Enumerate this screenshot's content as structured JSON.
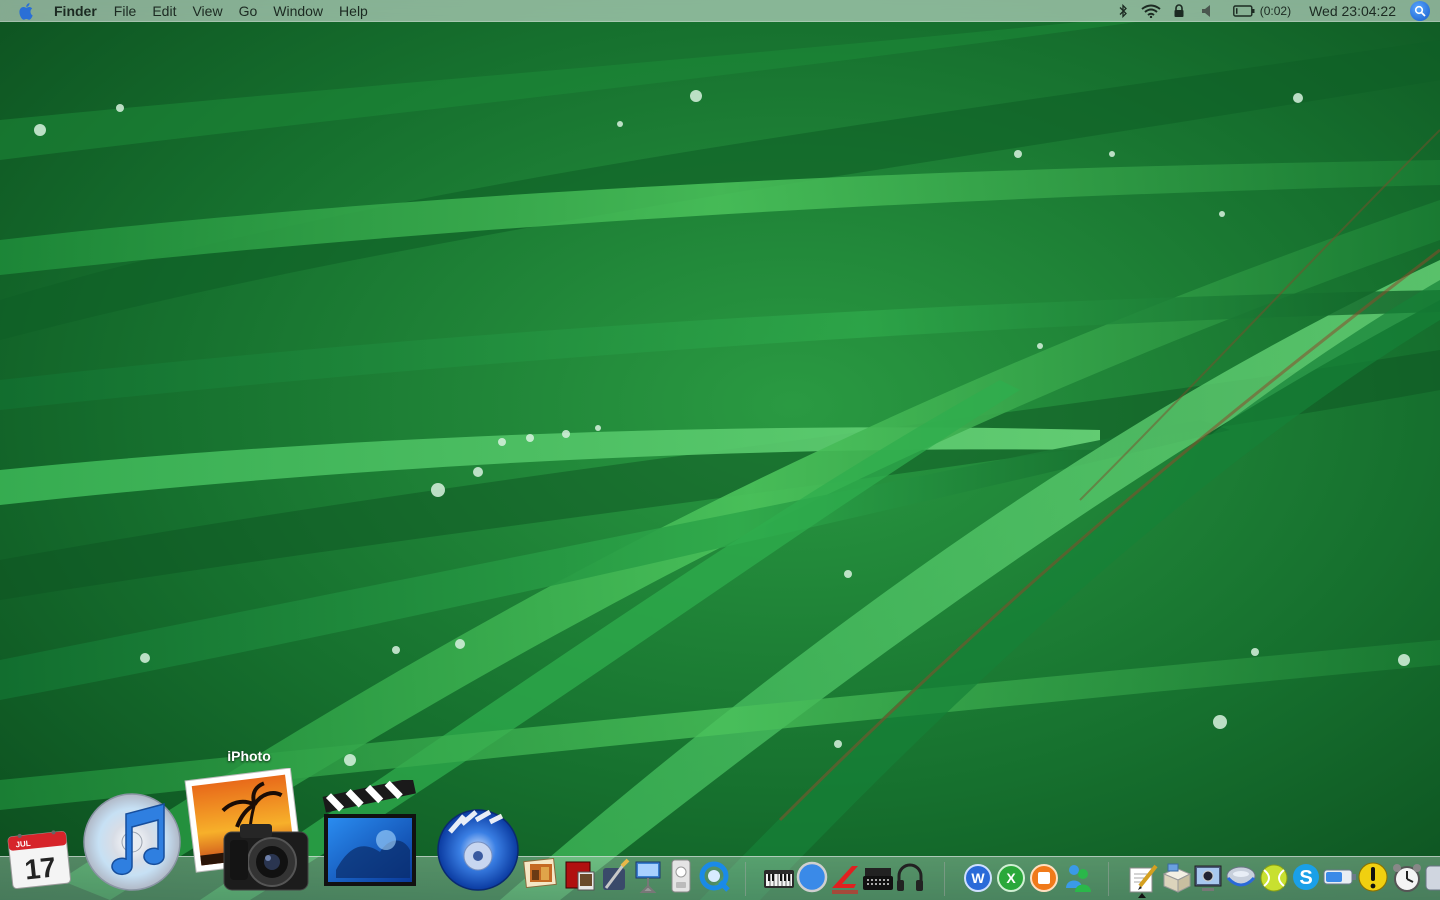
{
  "menubar": {
    "app_name": "Finder",
    "menus": [
      "File",
      "Edit",
      "View",
      "Go",
      "Window",
      "Help"
    ],
    "battery_time": "(0:02)",
    "clock": "Wed 23:04:22",
    "status_icons": [
      "bluetooth-icon",
      "wifi-icon",
      "lock-icon",
      "volume-icon",
      "battery-icon",
      "spotlight-icon"
    ]
  },
  "dock": {
    "hovered_tooltip": "iPhoto",
    "calendar": {
      "month": "JUL",
      "day": "17"
    },
    "apps": [
      "iCal",
      "iTunes",
      "iPhoto",
      "iMovie",
      "iDVD"
    ]
  },
  "colors": {
    "menubar_text": "#1c2a22",
    "grass_dark": "#0f5a24",
    "grass_light": "#4fc25e"
  }
}
